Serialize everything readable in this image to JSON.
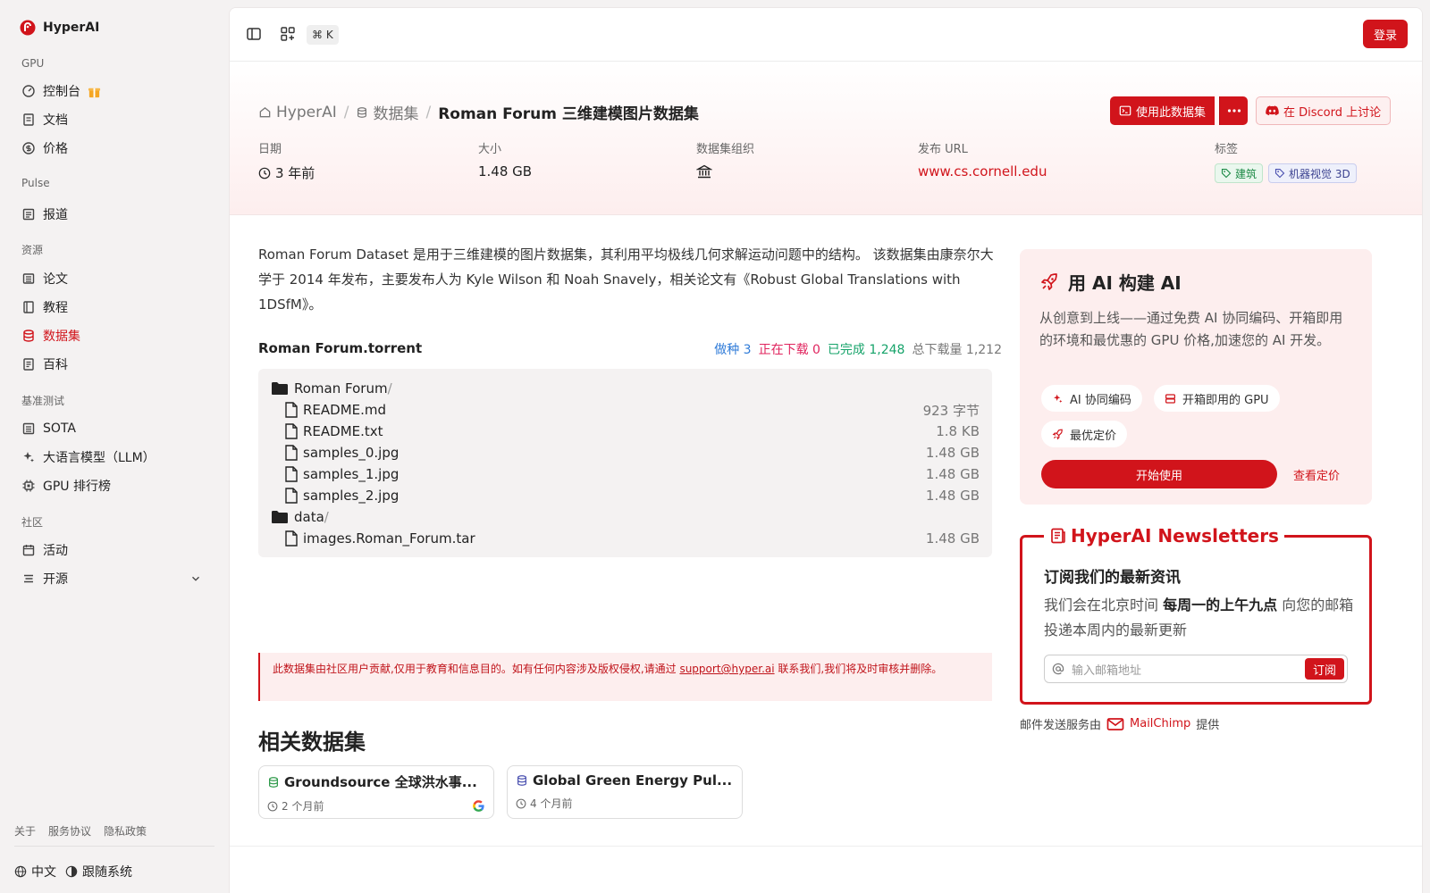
{
  "app": {
    "name": "HyperAI"
  },
  "sidebar": {
    "sections": [
      {
        "title": "GPU",
        "items": [
          {
            "label": "控制台"
          },
          {
            "label": "文档"
          },
          {
            "label": "价格"
          }
        ]
      },
      {
        "title": "Pulse",
        "items": [
          {
            "label": "报道"
          }
        ]
      },
      {
        "title": "资源",
        "items": [
          {
            "label": "论文"
          },
          {
            "label": "教程"
          },
          {
            "label": "数据集",
            "active": true
          },
          {
            "label": "百科"
          }
        ]
      },
      {
        "title": "基准测试",
        "items": [
          {
            "label": "SOTA"
          },
          {
            "label": "大语言模型（LLM）"
          },
          {
            "label": "GPU 排行榜"
          }
        ]
      },
      {
        "title": "社区",
        "items": [
          {
            "label": "活动"
          },
          {
            "label": "开源"
          }
        ]
      }
    ],
    "footer_links": [
      "关于",
      "服务协议",
      "隐私政策"
    ],
    "language": "中文",
    "theme": "跟随系统"
  },
  "topbar": {
    "shortcut": "⌘ K",
    "login_label": "登录"
  },
  "breadcrumb": {
    "home": "HyperAI",
    "section": "数据集",
    "current": "Roman Forum 三维建模图片数据集"
  },
  "actions": {
    "use_label": "使用此数据集",
    "discord_label": "在 Discord 上讨论"
  },
  "meta": {
    "date_label": "日期",
    "date_value": "3 年前",
    "size_label": "大小",
    "size_value": "1.48 GB",
    "org_label": "数据集组织",
    "url_label": "发布 URL",
    "url_value": "www.cs.cornell.edu",
    "tags_label": "标签",
    "tags": [
      "建筑",
      "机器视觉 3D"
    ]
  },
  "description": "Roman Forum Dataset 是用于三维建模的图片数据集，其利用平均极线几何求解运动问题中的结构。 该数据集由康奈尔大学于 2014 年发布，主要发布人为 Kyle Wilson 和 Noah Snavely，相关论文有《Robust Global Translations with 1DSfM》。",
  "torrent": {
    "title": "Roman Forum.torrent",
    "seeds": "做种 3",
    "downloading": "正在下载 0",
    "completed": "已完成 1,248",
    "total": "总下载量 1,212",
    "files": [
      {
        "name": "Roman Forum",
        "type": "folder",
        "size": ""
      },
      {
        "name": "README.md",
        "type": "file",
        "size": "923 字节"
      },
      {
        "name": "README.txt",
        "type": "file",
        "size": "1.8 KB"
      },
      {
        "name": "samples_0.jpg",
        "type": "file",
        "size": "1.48 GB"
      },
      {
        "name": "samples_1.jpg",
        "type": "file",
        "size": "1.48 GB"
      },
      {
        "name": "samples_2.jpg",
        "type": "file",
        "size": "1.48 GB"
      },
      {
        "name": "data",
        "type": "folder",
        "size": ""
      },
      {
        "name": "images.Roman_Forum.tar",
        "type": "file",
        "size": "1.48 GB"
      }
    ]
  },
  "notice": {
    "before": "此数据集由社区用户贡献,仅用于教育和信息目的。如有任何内容涉及版权侵权,请通过 ",
    "email": "support@hyper.ai",
    "after": " 联系我们,我们将及时审核并删除。"
  },
  "related": {
    "title": "相关数据集",
    "items": [
      {
        "title": "Groundsource 全球洪水事...",
        "date": "2 个月前"
      },
      {
        "title": "Global Green Energy Pul...",
        "date": "4 个月前"
      }
    ]
  },
  "ai_box": {
    "title": "用 AI 构建 AI",
    "text": "从创意到上线——通过免费 AI 协同编码、开箱即用的环境和最优惠的 GPU 价格,加速您的 AI 开发。",
    "chips": [
      "AI 协同编码",
      "开箱即用的 GPU",
      "最优定价"
    ],
    "start_label": "开始使用",
    "price_label": "查看定价"
  },
  "newsletter": {
    "title": "HyperAI Newsletters",
    "heading": "订阅我们的最新资讯",
    "text_before": "我们会在北京时间 ",
    "text_bold": "每周一的上午九点",
    "text_after": " 向您的邮箱投递本周内的最新更新",
    "placeholder": "输入邮箱地址",
    "subscribe_label": "订阅",
    "mail_before": "邮件发送服务由",
    "mail_brand": "MailChimp",
    "mail_after": "提供"
  },
  "colors": {
    "accent": "#d1141b",
    "seeds": "#2f7bd8",
    "downloading": "#e0245e",
    "completed": "#16a36a"
  }
}
